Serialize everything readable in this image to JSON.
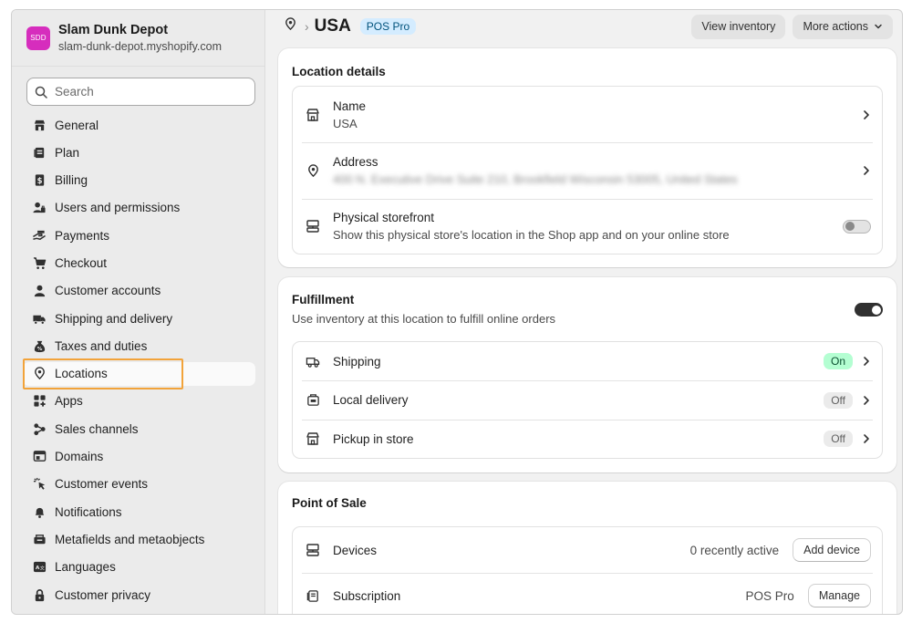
{
  "store": {
    "badge": "SDD",
    "name": "Slam Dunk Depot",
    "domain": "slam-dunk-depot.myshopify.com"
  },
  "search": {
    "placeholder": "Search"
  },
  "sidebar": {
    "items": [
      {
        "label": "General",
        "icon": "store-icon"
      },
      {
        "label": "Plan",
        "icon": "plan-icon"
      },
      {
        "label": "Billing",
        "icon": "billing-icon"
      },
      {
        "label": "Users and permissions",
        "icon": "users-icon"
      },
      {
        "label": "Payments",
        "icon": "payments-icon"
      },
      {
        "label": "Checkout",
        "icon": "cart-icon"
      },
      {
        "label": "Customer accounts",
        "icon": "person-icon"
      },
      {
        "label": "Shipping and delivery",
        "icon": "truck-icon"
      },
      {
        "label": "Taxes and duties",
        "icon": "tax-icon"
      },
      {
        "label": "Locations",
        "icon": "location-icon",
        "active": true
      },
      {
        "label": "Apps",
        "icon": "apps-icon"
      },
      {
        "label": "Sales channels",
        "icon": "channels-icon"
      },
      {
        "label": "Domains",
        "icon": "domains-icon"
      },
      {
        "label": "Customer events",
        "icon": "cursor-icon"
      },
      {
        "label": "Notifications",
        "icon": "bell-icon"
      },
      {
        "label": "Metafields and metaobjects",
        "icon": "metafields-icon"
      },
      {
        "label": "Languages",
        "icon": "language-icon"
      },
      {
        "label": "Customer privacy",
        "icon": "lock-icon"
      }
    ]
  },
  "header": {
    "title": "USA",
    "badge": "POS Pro",
    "view_inventory": "View inventory",
    "more_actions": "More actions"
  },
  "location_details": {
    "title": "Location details",
    "name_label": "Name",
    "name_value": "USA",
    "address_label": "Address",
    "address_value": "400 N. Executive Drive Suite 210, Brookfield Wisconsin 53005, United States",
    "storefront_label": "Physical storefront",
    "storefront_desc": "Show this physical store's location in the Shop app and on your online store",
    "storefront_enabled": false
  },
  "fulfillment": {
    "title": "Fulfillment",
    "desc": "Use inventory at this location to fulfill online orders",
    "enabled": true,
    "rows": [
      {
        "label": "Shipping",
        "status": "On",
        "icon": "truck-icon"
      },
      {
        "label": "Local delivery",
        "status": "Off",
        "icon": "local-delivery-icon"
      },
      {
        "label": "Pickup in store",
        "status": "Off",
        "icon": "store-icon"
      }
    ]
  },
  "pos": {
    "title": "Point of Sale",
    "devices_label": "Devices",
    "devices_status": "0 recently active",
    "add_device": "Add device",
    "subscription_label": "Subscription",
    "subscription_value": "POS Pro",
    "manage": "Manage"
  },
  "colors": {
    "badge_bg": "#d62dbd",
    "highlight": "#f2a33a",
    "on_badge": "#b4fed2",
    "pos_badge": "#d4ecff"
  }
}
